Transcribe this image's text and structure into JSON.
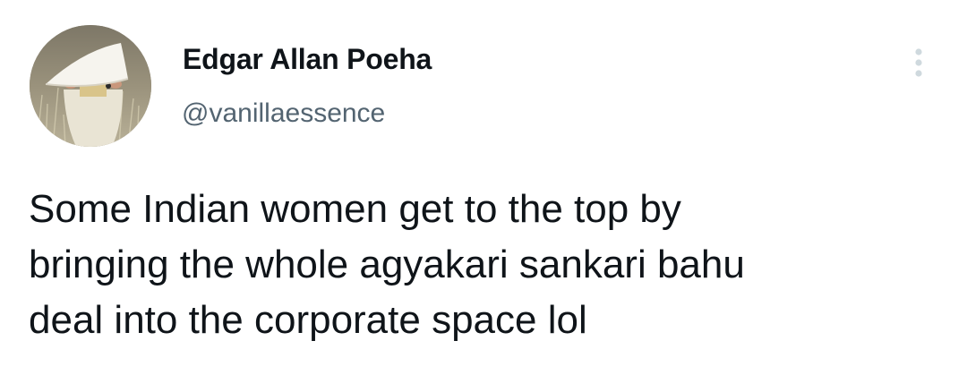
{
  "tweet": {
    "author": {
      "display_name": "Edgar Allan Poeha",
      "handle": "@vanillaessence",
      "avatar_icon": "avatar-photo-figure-in-white-hat-in-field"
    },
    "more_icon": "more-vertical-icon",
    "text": "Some Indian women get to the top by\nbringing the whole agyakari sankari bahu\ndeal into the corporate space lol"
  },
  "colors": {
    "text_primary": "#0f1419",
    "text_secondary": "#536471",
    "icon": "#cfd9de",
    "background": "#ffffff"
  }
}
